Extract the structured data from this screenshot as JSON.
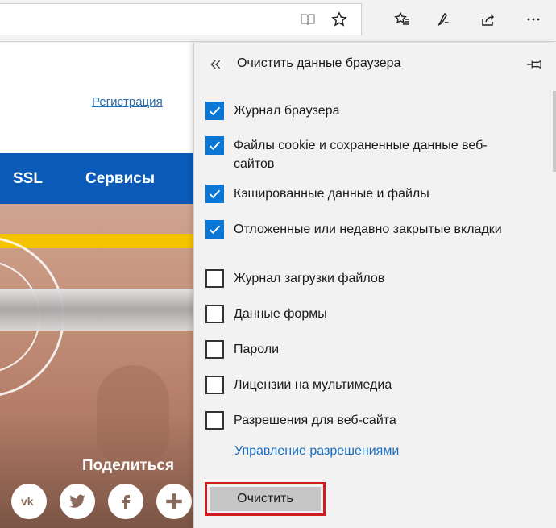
{
  "toolbar": {
    "icons": [
      "reading-view-icon",
      "favorite-star-icon",
      "favorites-hub-icon",
      "web-note-icon",
      "share-icon",
      "more-icon"
    ]
  },
  "site": {
    "register_link": "Регистрация",
    "nav": [
      "SSL",
      "Сервисы"
    ],
    "share_label": "Поделиться",
    "social": [
      "vk-icon",
      "twitter-icon",
      "facebook-icon",
      "plus-icon"
    ],
    "colors": {
      "nav_bg": "#0a5ab8",
      "accent_bar": "#f5c400"
    }
  },
  "panel": {
    "title": "Очистить данные браузера",
    "items": [
      {
        "label": "Журнал браузера",
        "checked": true
      },
      {
        "label": "Файлы cookie и сохраненные данные веб-сайтов",
        "checked": true
      },
      {
        "label": "Кэшированные данные и файлы",
        "checked": true
      },
      {
        "label": "Отложенные или недавно закрытые вкладки",
        "checked": true
      },
      {
        "label": "Журнал загрузки файлов",
        "checked": false
      },
      {
        "label": "Данные формы",
        "checked": false
      },
      {
        "label": "Пароли",
        "checked": false
      },
      {
        "label": "Лицензии на мультимедиа",
        "checked": false
      },
      {
        "label": "Разрешения для веб-сайта",
        "checked": false
      }
    ],
    "manage_link": "Управление разрешениями",
    "clear_button": "Очистить",
    "colors": {
      "checkbox_checked": "#0a77d6",
      "highlight": "#d01c1c",
      "link": "#1a6fc0"
    }
  }
}
